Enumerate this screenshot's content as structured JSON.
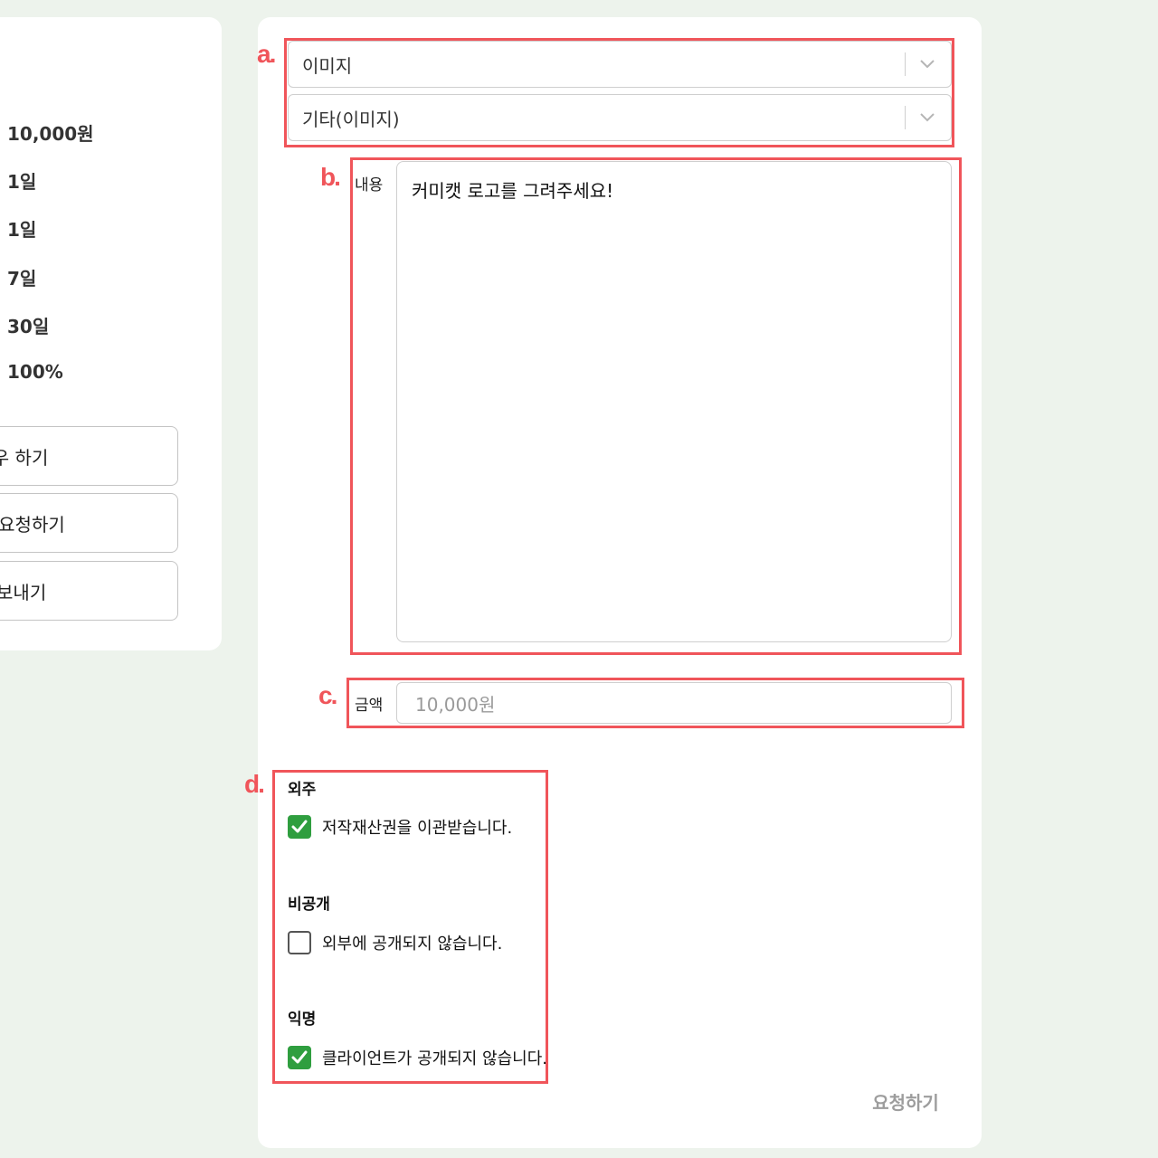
{
  "sidebar": {
    "stats": [
      "10,000원",
      "1일",
      "1일",
      "7일",
      "30일",
      "100%"
    ],
    "buttons": {
      "follow": "팔로우 하기",
      "request": "작업 요청하기",
      "dm": "DM 보내기"
    }
  },
  "form": {
    "category": "이미지",
    "subcategory": "기타(이미지)",
    "content_label": "내용",
    "content_value": "커미캣 로고를 그려주세요!",
    "amount_label": "금액",
    "amount_placeholder": "10,000원",
    "options": [
      {
        "title": "외주",
        "text": "저작재산권을 이관받습니다.",
        "checked": true
      },
      {
        "title": "비공개",
        "text": "외부에 공개되지 않습니다.",
        "checked": false
      },
      {
        "title": "익명",
        "text": "클라이언트가 공개되지 않습니다.",
        "checked": true
      }
    ],
    "submit_label": "요청하기"
  },
  "annotations": {
    "a": "a.",
    "b": "b.",
    "c": "c.",
    "d": "d."
  },
  "colors": {
    "annotation": "#f0555a",
    "checkbox_checked": "#2f9e3f",
    "page_background": "#edf3ec"
  },
  "icons": {
    "select_chevron": "chevron-down-icon",
    "check": "check-icon"
  }
}
